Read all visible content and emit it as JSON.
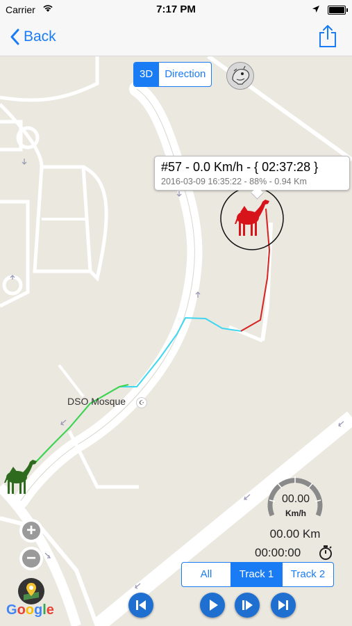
{
  "status_bar": {
    "carrier": "Carrier",
    "time": "7:17 PM"
  },
  "nav": {
    "back_label": "Back",
    "share_icon": "share-icon"
  },
  "map_controls": {
    "view_modes": [
      "3D",
      "Direction"
    ],
    "active_view_mode": "3D"
  },
  "callout": {
    "title": "#57  - 0.0 Km/h - { 02:37:28 }",
    "subtitle": "2016-03-09 16:35:22 - 88% - 0.94 Km"
  },
  "poi": {
    "label": "DSO Mosque"
  },
  "zoom": {
    "in_label": "+",
    "out_label": "−"
  },
  "attribution": {
    "letters": [
      {
        "ch": "G",
        "color": "#4285f4"
      },
      {
        "ch": "o",
        "color": "#ea4335"
      },
      {
        "ch": "o",
        "color": "#fbbc05"
      },
      {
        "ch": "g",
        "color": "#4285f4"
      },
      {
        "ch": "l",
        "color": "#34a853"
      },
      {
        "ch": "e",
        "color": "#ea4335"
      }
    ]
  },
  "stats": {
    "speed": "00.00",
    "speed_unit": "Km/h",
    "distance": "00.00 Km",
    "elapsed": "00:00:00"
  },
  "tracks": {
    "tabs": [
      "All",
      "Track 1",
      "Track 2"
    ],
    "active": "Track 1"
  },
  "playback": [
    "skip-back-icon",
    "play-icon",
    "step-forward-icon",
    "skip-forward-icon"
  ],
  "colors": {
    "accent": "#1a7cf5",
    "camel_current": "#d8141b",
    "camel_start": "#2f6b1e",
    "route_start": "#3fd34a",
    "route_mid": "#3fd6f0",
    "route_end": "#e2221e"
  }
}
